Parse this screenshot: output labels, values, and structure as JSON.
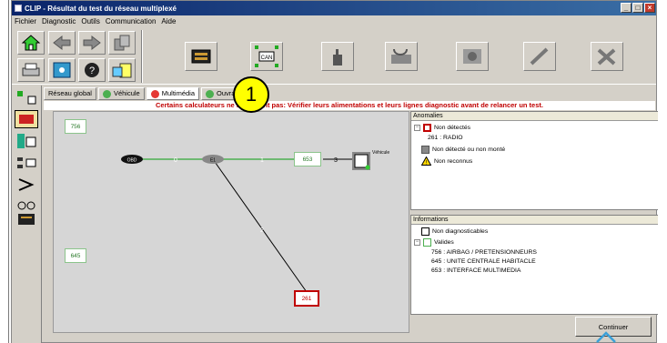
{
  "window": {
    "title": "CLIP - Résultat du test du réseau multiplexé",
    "min": "_",
    "max": "□",
    "close": "×"
  },
  "menu": [
    "Fichier",
    "Diagnostic",
    "Outils",
    "Communication",
    "Aide"
  ],
  "toolbar": {
    "can_label": "CAN"
  },
  "tabs": [
    {
      "label": "Réseau global",
      "color": ""
    },
    {
      "label": "Véhicule",
      "color": "#4caf50"
    },
    {
      "label": "Multimédia",
      "color": "#e53935"
    },
    {
      "label": "Ouvrants",
      "color": "#4caf50"
    }
  ],
  "warning_text": "Certains calculateurs ne répondent pas: Vérifier leurs alimentations et leurs lignes diagnostic avant de relancer un test.",
  "network": {
    "obd": "OBD",
    "e1": "E1",
    "line_labels": [
      "0",
      "1",
      "3",
      "2"
    ],
    "ecus": [
      {
        "id": "756",
        "status": "valid"
      },
      {
        "id": "645",
        "status": "valid"
      },
      {
        "id": "653",
        "status": "valid"
      },
      {
        "id": "261",
        "status": "not_detected"
      }
    ],
    "vehicle_label": "Véhicule"
  },
  "anomalies": {
    "header": "Anomalies",
    "not_detected": "Non détectés",
    "item_261": "261 : RADIO",
    "not_detected_or_mounted": "Non détecté ou non monté",
    "not_recognized": "Non reconnus"
  },
  "informations": {
    "header": "Informations",
    "not_diagnosable": "Non diagnosticables",
    "valid": "Valides",
    "items": [
      "756 : AIRBAG / PRETENSIONNEURS",
      "645 : UNITE CENTRALE HABITACLE",
      "653 : INTERFACE MULTIMEDIA"
    ]
  },
  "continue_button": "Continuer",
  "callout_number": "1",
  "colors": {
    "titlebar": "#0a246a",
    "warning": "#c00000",
    "valid": "#8bc48b",
    "error": "#c00000",
    "line": "#4caf50"
  }
}
